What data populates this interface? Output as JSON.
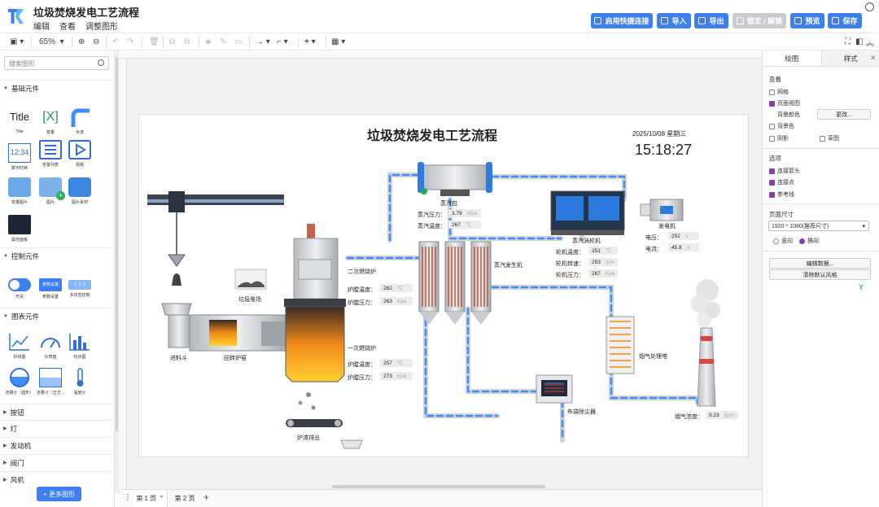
{
  "app": {
    "title": "垃圾焚烧发电工艺流程",
    "menu": [
      "编辑",
      "查看",
      "调整图形"
    ]
  },
  "toolbar_buttons": {
    "quick_connect": "启用快捷连接",
    "import": "导入",
    "export": "导出",
    "lock": "锁定 / 解锁",
    "preview": "预览",
    "save": "保存"
  },
  "toolbar": {
    "zoom": "65%"
  },
  "sidebar": {
    "search_placeholder": "搜索图形",
    "categories": {
      "basic": "基础元件",
      "control": "控制元件",
      "chart": "图表元件",
      "button": "按钮",
      "light": "灯",
      "engine": "发动机",
      "valve": "阀门",
      "fan": "风机"
    },
    "basic_items": [
      "Title",
      "变量",
      "水流",
      "数字时钟",
      "告警列表",
      "视频",
      "变量图片",
      "图片",
      "图片素材",
      "属性面板"
    ],
    "control_items": [
      "开关",
      "参数设置",
      "多状态控制"
    ],
    "chart_items": [
      "折线图",
      "仪表盘",
      "柱状图",
      "流量计（圆形）",
      "流量计（正方...",
      "温度计"
    ],
    "more_button": "+ 更多图形"
  },
  "pages": {
    "page1": "第 1 页",
    "page2": "第 2 页"
  },
  "right_panel": {
    "tabs": [
      "绘图",
      "样式"
    ],
    "view_section": "查看",
    "grid": "网格",
    "page_view": "页面视图",
    "bg_color": "背景颜色",
    "change_button": "更改...",
    "bg_image": "背景色",
    "shadow": "阴影",
    "sketch": "草图",
    "options_section": "选项",
    "connect_arrows": "连接箭头",
    "connect_points": "连接点",
    "guides": "参考线",
    "page_size_section": "页面尺寸",
    "page_size_value": "1920 * 1080(推荐尺寸)",
    "portrait": "竖向",
    "landscape": "横向",
    "edit_data_button": "编辑数据...",
    "clear_style_button": "清除默认风格"
  },
  "diagram": {
    "title": "垃圾焚烧发电工艺流程",
    "date": "2025/10/08 星期三",
    "time": "15:18:27",
    "labels": {
      "steam_drum": "蒸汽包",
      "steam_pressure": "蒸汽压力：",
      "steam_pressure_val": "3.79",
      "steam_pressure_unit": "Mpa",
      "steam_temp": "蒸汽温度：",
      "steam_temp_val": "267",
      "steam_temp_unit": "℃",
      "turbine": "蒸汽涡轮机",
      "turbine_temp": "轮机温度：",
      "turbine_temp_val": "251",
      "turbine_temp_unit": "℃",
      "turbine_speed": "轮机转速：",
      "turbine_speed_val": "293",
      "turbine_speed_unit": "rpm",
      "turbine_pressure": "轮机压力：",
      "turbine_pressure_val": "267",
      "turbine_pressure_unit": "Kpa",
      "generator": "发电机",
      "voltage": "电压：",
      "voltage_val": "252",
      "voltage_unit": "V",
      "current": "电流：",
      "current_val": "45.8",
      "current_unit": "A",
      "secondary_furnace": "二次燃烧炉",
      "sec_temp": "炉膛温度：",
      "sec_temp_val": "262",
      "sec_temp_unit": "℃",
      "sec_pressure": "炉膛压力：",
      "sec_pressure_val": "263",
      "sec_pressure_unit": "Kpa",
      "primary_furnace": "一次燃烧炉",
      "pri_temp": "炉膛温度：",
      "pri_temp_val": "257",
      "pri_temp_unit": "℃",
      "pri_pressure": "炉膛压力：",
      "pri_pressure_val": "273",
      "pri_pressure_unit": "Kpa",
      "steam_generator": "蒸汽发生机",
      "garbage_field": "垃圾堆场",
      "feed_hopper": "进料斗",
      "rotary_kiln": "回转炉窑",
      "slag_discharge": "炉渣排出",
      "bag_filter": "布袋除尘器",
      "flue_tower": "烟气处理塔",
      "smoke_conc": "烟气浓度：",
      "smoke_conc_val": "9.23",
      "smoke_conc_unit": "ppm"
    }
  },
  "colors": {
    "accent": "#3d7ef0",
    "pipe": "#c9ccd1",
    "pipe_dash": "#3d8ef5",
    "checkbox": "#8e3bb1"
  }
}
